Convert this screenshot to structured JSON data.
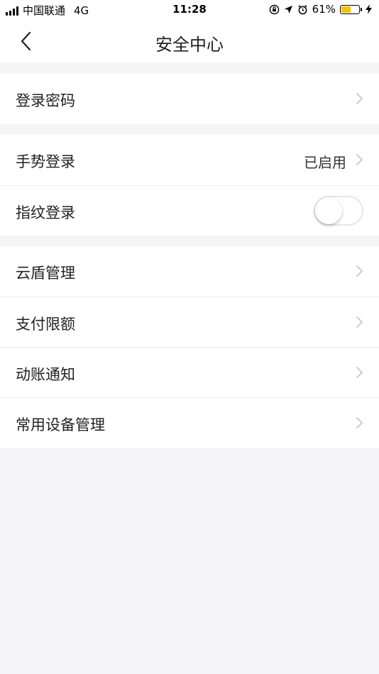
{
  "status_bar": {
    "carrier": "中国联通",
    "network": "4G",
    "time": "11:28",
    "battery_percent_text": "61%",
    "battery_level": 0.61,
    "battery_color": "#f5c400",
    "icons": [
      "signal-icon",
      "rotation-lock-icon",
      "location-icon",
      "alarm-icon",
      "battery-icon",
      "charging-icon"
    ]
  },
  "nav": {
    "title": "安全中心",
    "back_icon": "back-chevron-icon"
  },
  "groups": [
    {
      "items": [
        {
          "label": "登录密码",
          "type": "link"
        }
      ]
    },
    {
      "items": [
        {
          "label": "手势登录",
          "value": "已启用",
          "type": "link"
        },
        {
          "label": "指纹登录",
          "type": "toggle",
          "enabled": false
        }
      ]
    },
    {
      "items": [
        {
          "label": "云盾管理",
          "type": "link"
        },
        {
          "label": "支付限额",
          "type": "link"
        },
        {
          "label": "动账通知",
          "type": "link"
        },
        {
          "label": "常用设备管理",
          "type": "link"
        }
      ]
    }
  ],
  "colors": {
    "background": "#f5f5f7",
    "card": "#ffffff",
    "chevron": "#c7c7cc",
    "divider": "#eeeeee"
  }
}
